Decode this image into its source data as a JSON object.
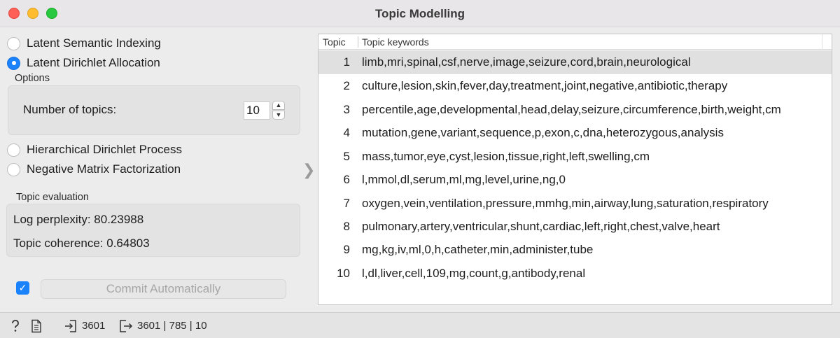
{
  "window": {
    "title": "Topic Modelling"
  },
  "methods": [
    {
      "label": "Latent Semantic Indexing",
      "checked": false
    },
    {
      "label": "Latent Dirichlet Allocation",
      "checked": true
    },
    {
      "label": "Hierarchical Dirichlet Process",
      "checked": false
    },
    {
      "label": "Negative Matrix Factorization",
      "checked": false
    }
  ],
  "options": {
    "label": "Options",
    "num_topics_label": "Number of topics:",
    "num_topics_value": "10"
  },
  "evaluation": {
    "label": "Topic evaluation",
    "log_perplexity": "Log perplexity: 80.23988",
    "topic_coherence": "Topic coherence: 0.64803"
  },
  "commit": {
    "label": "Commit Automatically",
    "checked": true
  },
  "table": {
    "headers": [
      "Topic",
      "Topic keywords"
    ],
    "rows": [
      {
        "topic": "1",
        "keywords": "limb,mri,spinal,csf,nerve,image,seizure,cord,brain,neurological"
      },
      {
        "topic": "2",
        "keywords": "culture,lesion,skin,fever,day,treatment,joint,negative,antibiotic,therapy"
      },
      {
        "topic": "3",
        "keywords": "percentile,age,developmental,head,delay,seizure,circumference,birth,weight,cm"
      },
      {
        "topic": "4",
        "keywords": "mutation,gene,variant,sequence,p,exon,c,dna,heterozygous,analysis"
      },
      {
        "topic": "5",
        "keywords": "mass,tumor,eye,cyst,lesion,tissue,right,left,swelling,cm"
      },
      {
        "topic": "6",
        "keywords": "l,mmol,dl,serum,ml,mg,level,urine,ng,0"
      },
      {
        "topic": "7",
        "keywords": "oxygen,vein,ventilation,pressure,mmhg,min,airway,lung,saturation,respiratory"
      },
      {
        "topic": "8",
        "keywords": "pulmonary,artery,ventricular,shunt,cardiac,left,right,chest,valve,heart"
      },
      {
        "topic": "9",
        "keywords": "mg,kg,iv,ml,0,h,catheter,min,administer,tube"
      },
      {
        "topic": "10",
        "keywords": "l,dl,liver,cell,109,mg,count,g,antibody,renal"
      }
    ],
    "selected_row": 0
  },
  "status": {
    "input_count": "3601",
    "output_summary": "3601 | 785 | 10",
    "icons": [
      "help-icon",
      "report-icon",
      "input-icon",
      "output-icon"
    ]
  }
}
